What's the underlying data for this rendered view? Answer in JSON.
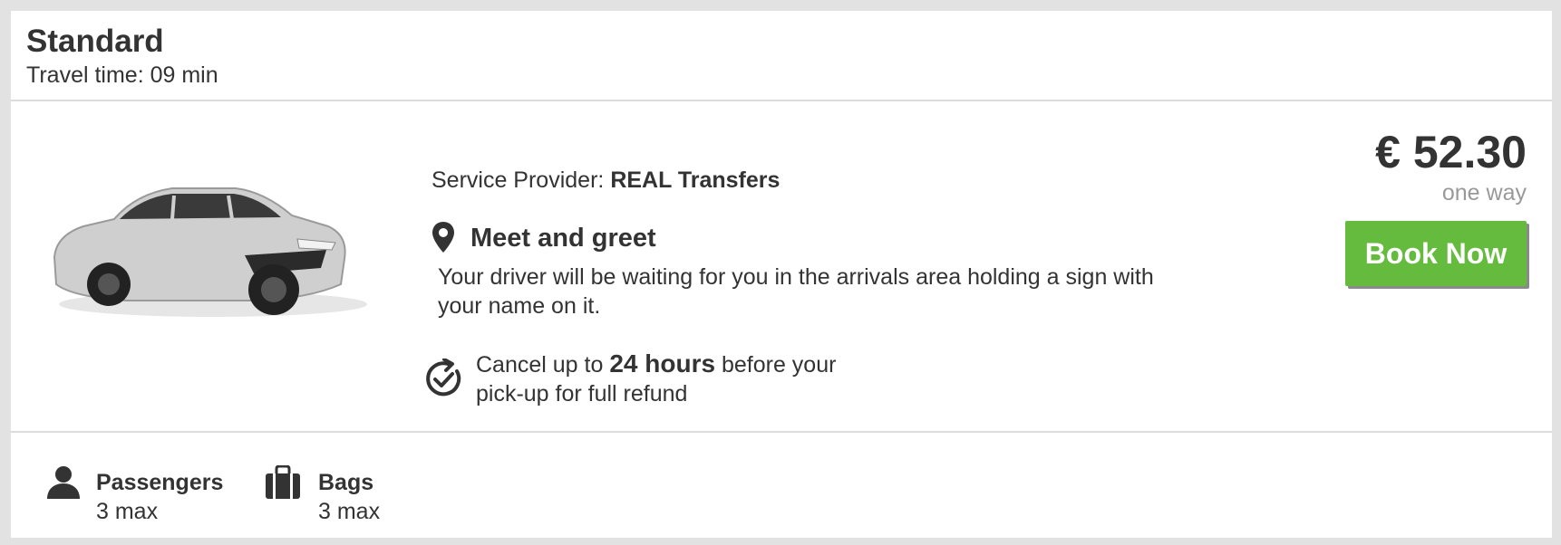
{
  "header": {
    "title": "Standard",
    "travel_time": "Travel time: 09 min"
  },
  "car_image": {
    "icon": "sedan-car-image",
    "color": "#c8c8c8"
  },
  "provider": {
    "label": "Service Provider:",
    "name": "REAL Transfers"
  },
  "meet": {
    "icon": "location-pin-icon",
    "title": "Meet and greet",
    "description": "Your driver will be waiting for you in the arrivals area holding a sign with your name on it."
  },
  "cancel": {
    "icon": "refresh-check-icon",
    "text_before": "Cancel up to ",
    "text_bold": "24 hours",
    "text_after": " before your pick-up for full refund"
  },
  "price": {
    "amount": "€ 52.30",
    "per": "one way"
  },
  "book_button": {
    "label": "Book Now",
    "color": "#64bb3e"
  },
  "features": {
    "passengers": {
      "icon": "person-icon",
      "label": "Passengers",
      "value": "3 max"
    },
    "bags": {
      "icon": "briefcase-icon",
      "label": "Bags",
      "value": "3 max"
    }
  }
}
